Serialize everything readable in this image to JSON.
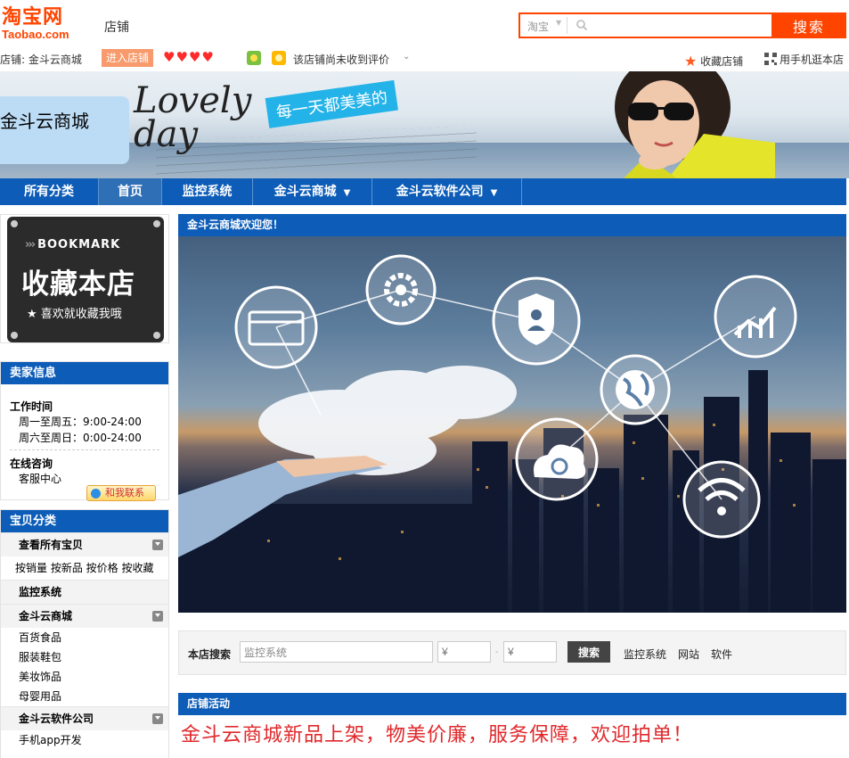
{
  "header": {
    "logo_cn": "淘宝网",
    "logo_en": "Taobao.com",
    "shop_label": "店铺",
    "search": {
      "scope": "淘宝",
      "button": "搜索",
      "value": ""
    }
  },
  "shop_info": {
    "name_label": "店铺:",
    "name": "金斗云商城",
    "enter_button": "进入店铺",
    "hearts": "♥♥♥♥",
    "no_review": "该店铺尚未收到评价",
    "favorite": "收藏店铺",
    "mobile": "用手机逛本店"
  },
  "banner": {
    "shop_title": "金斗云商城",
    "lovely_line1": "Lovely",
    "lovely_line2": "day",
    "slogan": "每一天都美美的"
  },
  "nav": {
    "items": [
      {
        "label": "所有分类",
        "dropdown": false
      },
      {
        "label": "首页",
        "dropdown": false
      },
      {
        "label": "监控系统",
        "dropdown": false
      },
      {
        "label": "金斗云商城",
        "dropdown": true
      },
      {
        "label": "金斗云软件公司",
        "dropdown": true
      }
    ],
    "caret": "▼"
  },
  "bookmark": {
    "en": "BOOKMARK",
    "en_mark": "›››",
    "cn": "收藏本店",
    "sub": "★ 喜欢就收藏我哦"
  },
  "seller": {
    "title": "卖家信息",
    "work_time_title": "工作时间",
    "weekday": "周一至周五：9:00-24:00",
    "weekend": "周六至周日：0:00-24:00",
    "consult_title": "在线咨询",
    "service": "客服中心",
    "contact_button": "和我联系"
  },
  "categories": {
    "title": "宝贝分类",
    "all": "查看所有宝贝",
    "sort_links": "按销量 按新品 按价格 按收藏",
    "group1": "监控系统",
    "group2": "金斗云商城",
    "group2_items": [
      "百货食品",
      "服装鞋包",
      "美妆饰品",
      "母婴用品"
    ],
    "group3": "金斗云软件公司",
    "group3_items": [
      "手机app开发"
    ]
  },
  "main": {
    "welcome_title": "金斗云商城欢迎您！",
    "search_panel": {
      "label": "本店搜索",
      "keyword": "监控系统",
      "price_from": "¥",
      "price_to": "¥",
      "dash": "-",
      "button": "搜索",
      "links": [
        "监控系统",
        "网站",
        "软件"
      ]
    },
    "activity_title": "店铺活动",
    "activity_text": "金斗云商城新品上架，物美价廉，服务保障，欢迎拍单！"
  },
  "colors": {
    "taobao_orange": "#ff4400",
    "nav_blue": "#0d5db8",
    "promo_red": "#e0282b"
  }
}
